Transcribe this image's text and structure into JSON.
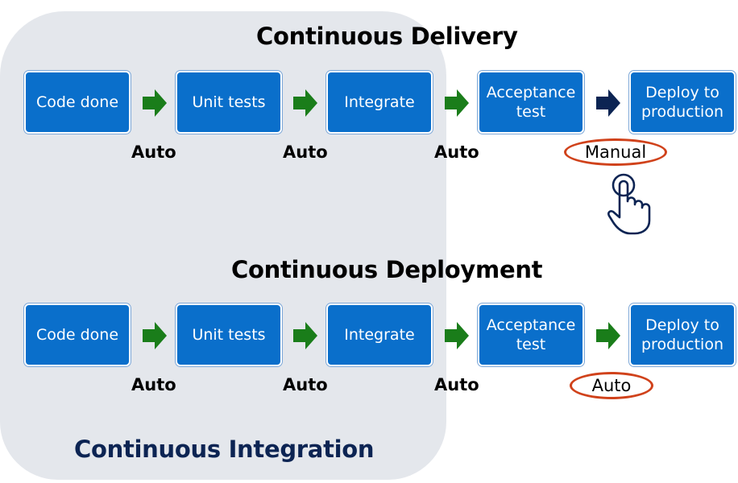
{
  "continuous_integration": {
    "title": "Continuous Integration"
  },
  "delivery": {
    "title": "Continuous Delivery",
    "steps": [
      "Code done",
      "Unit tests",
      "Integrate",
      "Acceptance\ntest",
      "Deploy to\nproduction"
    ],
    "transitions": [
      {
        "label": "Auto",
        "arrow_color": "#1a7d1a",
        "highlighted": false
      },
      {
        "label": "Auto",
        "arrow_color": "#1a7d1a",
        "highlighted": false
      },
      {
        "label": "Auto",
        "arrow_color": "#1a7d1a",
        "highlighted": false
      },
      {
        "label": "Manual",
        "arrow_color": "#0c2453",
        "highlighted": true
      }
    ],
    "manual_icon": "hand-pointer-icon"
  },
  "deployment": {
    "title": "Continuous Deployment",
    "steps": [
      "Code done",
      "Unit tests",
      "Integrate",
      "Acceptance\ntest",
      "Deploy to\nproduction"
    ],
    "transitions": [
      {
        "label": "Auto",
        "arrow_color": "#1a7d1a",
        "highlighted": false
      },
      {
        "label": "Auto",
        "arrow_color": "#1a7d1a",
        "highlighted": false
      },
      {
        "label": "Auto",
        "arrow_color": "#1a7d1a",
        "highlighted": false
      },
      {
        "label": "Auto",
        "arrow_color": "#1a7d1a",
        "highlighted": true
      }
    ]
  },
  "colors": {
    "box": "#0a6fcb",
    "auto_arrow": "#1a7d1a",
    "manual_arrow": "#0c2453",
    "highlight_oval": "#d0421b",
    "ci_panel": "#e4e7ec"
  }
}
